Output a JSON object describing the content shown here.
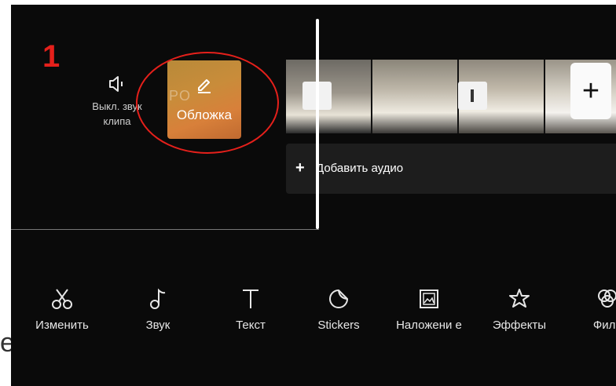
{
  "annotation": {
    "step_number": "1"
  },
  "left_panel": {
    "mute_label": "Выкл. звук клипа",
    "mute_icon": "speaker-off-icon"
  },
  "cover": {
    "label": "Обложка",
    "faint_text": "PO",
    "icon": "pencil-icon"
  },
  "timeline": {
    "add_clip_icon": "plus-icon",
    "audio_label": "Добавить аудио",
    "audio_icon": "plus-icon"
  },
  "toolbar": {
    "items": [
      {
        "label": "Изменить",
        "icon": "scissors-icon"
      },
      {
        "label": "Звук",
        "icon": "music-note-icon"
      },
      {
        "label": "Текст",
        "icon": "text-icon"
      },
      {
        "label": "Stickers",
        "icon": "sticker-icon"
      },
      {
        "label": "Наложени е",
        "icon": "overlay-icon"
      },
      {
        "label": "Эффекты",
        "icon": "effects-star-icon"
      },
      {
        "label": "Филь",
        "icon": "filter-icon"
      }
    ]
  },
  "outside_text": "е",
  "colors": {
    "annotation_red": "#e5201b",
    "app_background": "#0a0a0a",
    "audio_bar": "#1d1d1d"
  }
}
